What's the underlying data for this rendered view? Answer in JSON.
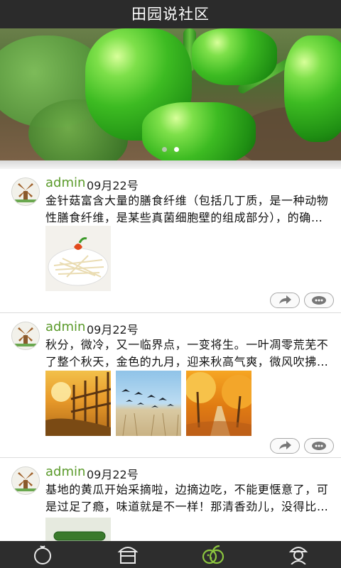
{
  "app": {
    "title": "田园说社区"
  },
  "banner": {
    "slides": 2,
    "active_slide": 2
  },
  "posts": [
    {
      "user": "admin",
      "date": "09月22号",
      "text": "金针菇富含大量的膳食纤维（包括几丁质，是一种动物性膳食纤维，是某些真菌细胞壁的组成部分），的确不易…",
      "images": [
        "enoki-mushroom-dish"
      ]
    },
    {
      "user": "admin",
      "date": "09月22号",
      "text": "秋分，微冷，又一临界点，一变将生。一叶凋零荒芜不了整个秋天，金色的九月，迎来秋高气爽，微风吹拂，飘…",
      "images": [
        "autumn-fence-photo",
        "flying-birds-photo",
        "autumn-trees-path-photo"
      ]
    },
    {
      "user": "admin",
      "date": "09月22号",
      "text": "基地的黄瓜开始采摘啦，边摘边吃，不能更惬意了，可是过足了瘾，味道就是不一样！那清香劲儿，没得比了！",
      "images": [
        "cucumber-photo"
      ]
    }
  ],
  "tabbar": {
    "items": [
      {
        "icon": "tomato-icon",
        "active": false
      },
      {
        "icon": "shop-icon",
        "active": false
      },
      {
        "icon": "fruit-icon",
        "active": true
      },
      {
        "icon": "user-icon",
        "active": false
      }
    ]
  },
  "colors": {
    "accent": "#5a9a2a",
    "titlebar": "#2b2b2b",
    "tabbar": "#2d2d2d"
  }
}
